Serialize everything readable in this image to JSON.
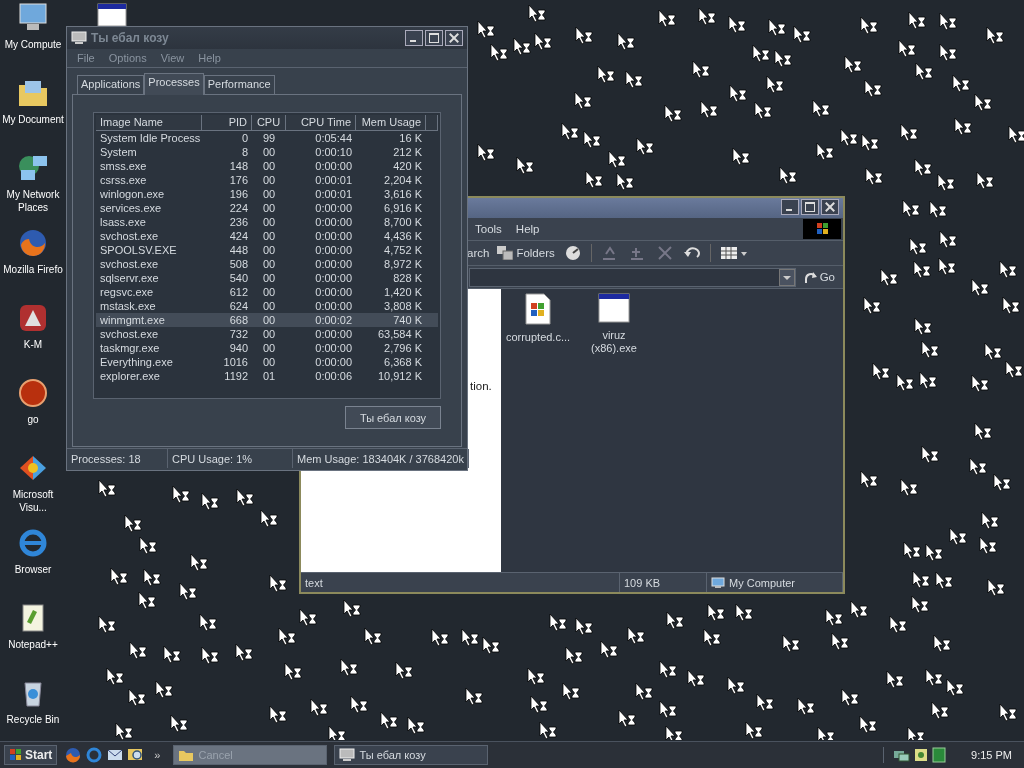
{
  "desktop_icons": [
    {
      "kind": "computer",
      "label": "My Compute"
    },
    {
      "kind": "documents",
      "label": "My Document"
    },
    {
      "kind": "network",
      "label": "My Network Places"
    },
    {
      "kind": "firefox",
      "label": "Mozilla Firefo"
    },
    {
      "kind": "kmeleon",
      "label": "K-M"
    },
    {
      "kind": "orb",
      "label": "go"
    },
    {
      "kind": "msvs",
      "label": "Microsoft Visu..."
    },
    {
      "kind": "ie",
      "label": "Browser"
    },
    {
      "kind": "notepad",
      "label": "Notepad++"
    },
    {
      "kind": "recycle",
      "label": "Recycle Bin"
    }
  ],
  "task_manager": {
    "title": "Ты ебал козу",
    "menu": [
      "File",
      "Options",
      "View",
      "Help"
    ],
    "tabs": [
      {
        "label": "Applications",
        "selected": false
      },
      {
        "label": "Processes",
        "selected": true
      },
      {
        "label": "Performance",
        "selected": false
      }
    ],
    "columns": [
      "Image Name",
      "PID",
      "CPU",
      "CPU Time",
      "Mem Usage"
    ],
    "rows": [
      {
        "cells": [
          "System Idle Process",
          "0",
          "99",
          "0:05:44",
          "16 K"
        ],
        "selected": false
      },
      {
        "cells": [
          "System",
          "8",
          "00",
          "0:00:10",
          "212 K"
        ],
        "selected": false
      },
      {
        "cells": [
          "smss.exe",
          "148",
          "00",
          "0:00:00",
          "420 K"
        ],
        "selected": false
      },
      {
        "cells": [
          "csrss.exe",
          "176",
          "00",
          "0:00:01",
          "2,204 K"
        ],
        "selected": false
      },
      {
        "cells": [
          "winlogon.exe",
          "196",
          "00",
          "0:00:01",
          "3,616 K"
        ],
        "selected": false
      },
      {
        "cells": [
          "services.exe",
          "224",
          "00",
          "0:00:00",
          "6,916 K"
        ],
        "selected": false
      },
      {
        "cells": [
          "lsass.exe",
          "236",
          "00",
          "0:00:00",
          "8,700 K"
        ],
        "selected": false
      },
      {
        "cells": [
          "svchost.exe",
          "424",
          "00",
          "0:00:00",
          "4,436 K"
        ],
        "selected": false
      },
      {
        "cells": [
          "SPOOLSV.EXE",
          "448",
          "00",
          "0:00:00",
          "4,752 K"
        ],
        "selected": false
      },
      {
        "cells": [
          "svchost.exe",
          "508",
          "00",
          "0:00:00",
          "8,972 K"
        ],
        "selected": false
      },
      {
        "cells": [
          "sqlservr.exe",
          "540",
          "00",
          "0:00:00",
          "828 K"
        ],
        "selected": false
      },
      {
        "cells": [
          "regsvc.exe",
          "612",
          "00",
          "0:00:00",
          "1,420 K"
        ],
        "selected": false
      },
      {
        "cells": [
          "mstask.exe",
          "624",
          "00",
          "0:00:00",
          "3,808 K"
        ],
        "selected": false
      },
      {
        "cells": [
          "winmgmt.exe",
          "668",
          "00",
          "0:00:02",
          "740 K"
        ],
        "selected": true
      },
      {
        "cells": [
          "svchost.exe",
          "732",
          "00",
          "0:00:00",
          "63,584 K"
        ],
        "selected": false
      },
      {
        "cells": [
          "taskmgr.exe",
          "940",
          "00",
          "0:00:00",
          "2,796 K"
        ],
        "selected": false
      },
      {
        "cells": [
          "Everything.exe",
          "1016",
          "00",
          "0:00:00",
          "6,368 K"
        ],
        "selected": false
      },
      {
        "cells": [
          "explorer.exe",
          "1192",
          "01",
          "0:00:06",
          "10,912 K"
        ],
        "selected": false
      }
    ],
    "button": "Ты ебал козу",
    "status": [
      "Processes: 18",
      "CPU Usage: 1%",
      "Mem Usage: 183404K / 3768420k"
    ]
  },
  "explorer": {
    "menu": [
      "Tools",
      "Help"
    ],
    "toolbar": {
      "search": "arch",
      "folders": "Folders"
    },
    "go": "Go",
    "side_text": "tion.",
    "files": [
      {
        "kind": "script",
        "label": "corrupted.c..."
      },
      {
        "kind": "window",
        "label": "viruz (x86).exe"
      }
    ],
    "status": [
      "text",
      "109 KB",
      "My Computer"
    ]
  },
  "taskbar": {
    "start": "Start",
    "more": "»",
    "tasks": [
      {
        "label": "Cancel",
        "kind": "folder",
        "selected": true
      },
      {
        "label": "Ты ебал козу",
        "kind": "taskmgr",
        "selected": false
      }
    ],
    "clock": "9:15 PM"
  }
}
